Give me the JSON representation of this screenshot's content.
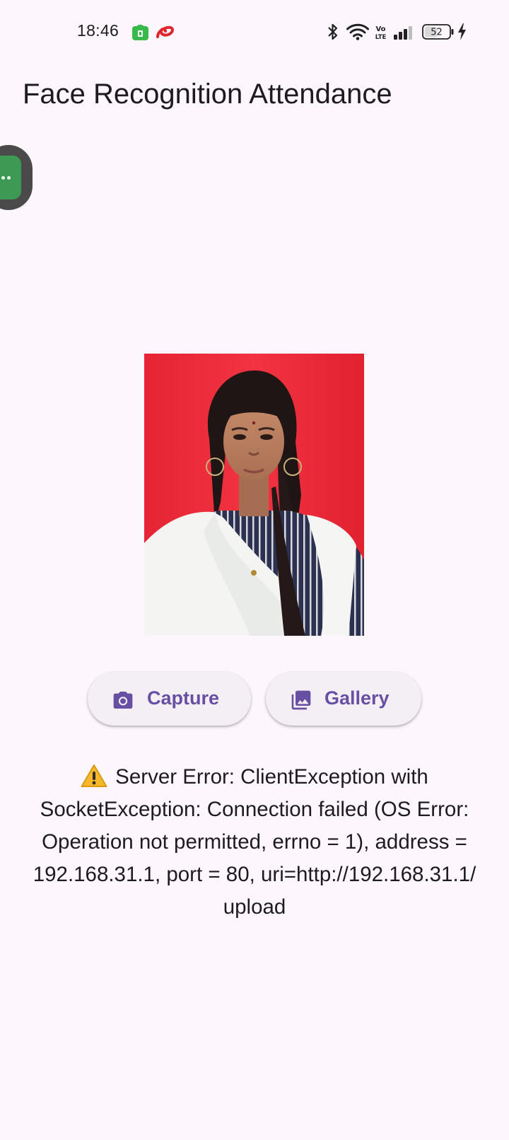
{
  "status_bar": {
    "time": "18:46",
    "battery_level": "52",
    "icons": [
      "app-store-icon",
      "airtel-icon",
      "bluetooth-icon",
      "wifi-icon",
      "volte-icon",
      "signal-icon",
      "battery-icon",
      "charging-icon"
    ],
    "volte_label": "Vo\nLTE"
  },
  "app_bar": {
    "title": "Face Recognition Attendance"
  },
  "floating_bubble": {
    "icon": "chat-bubble-icon",
    "color": "#3d9a55"
  },
  "image_preview": {
    "background_color": "#ec2b38"
  },
  "buttons": {
    "capture": {
      "label": "Capture",
      "icon": "camera-icon"
    },
    "gallery": {
      "label": "Gallery",
      "icon": "photo-library-icon"
    }
  },
  "error": {
    "icon": "warning-icon",
    "lines": [
      "Server Error: ClientException with",
      "SocketException: Connection failed (OS Error:",
      "Operation not permitted, errno = 1), address =",
      "192.168.31.1, port = 80, uri=http://192.168.31.1/",
      "upload"
    ]
  },
  "colors": {
    "background": "#fdf7fd",
    "primary": "#6750a4",
    "button_surface": "#f4eff4",
    "text": "#1d1b20"
  }
}
